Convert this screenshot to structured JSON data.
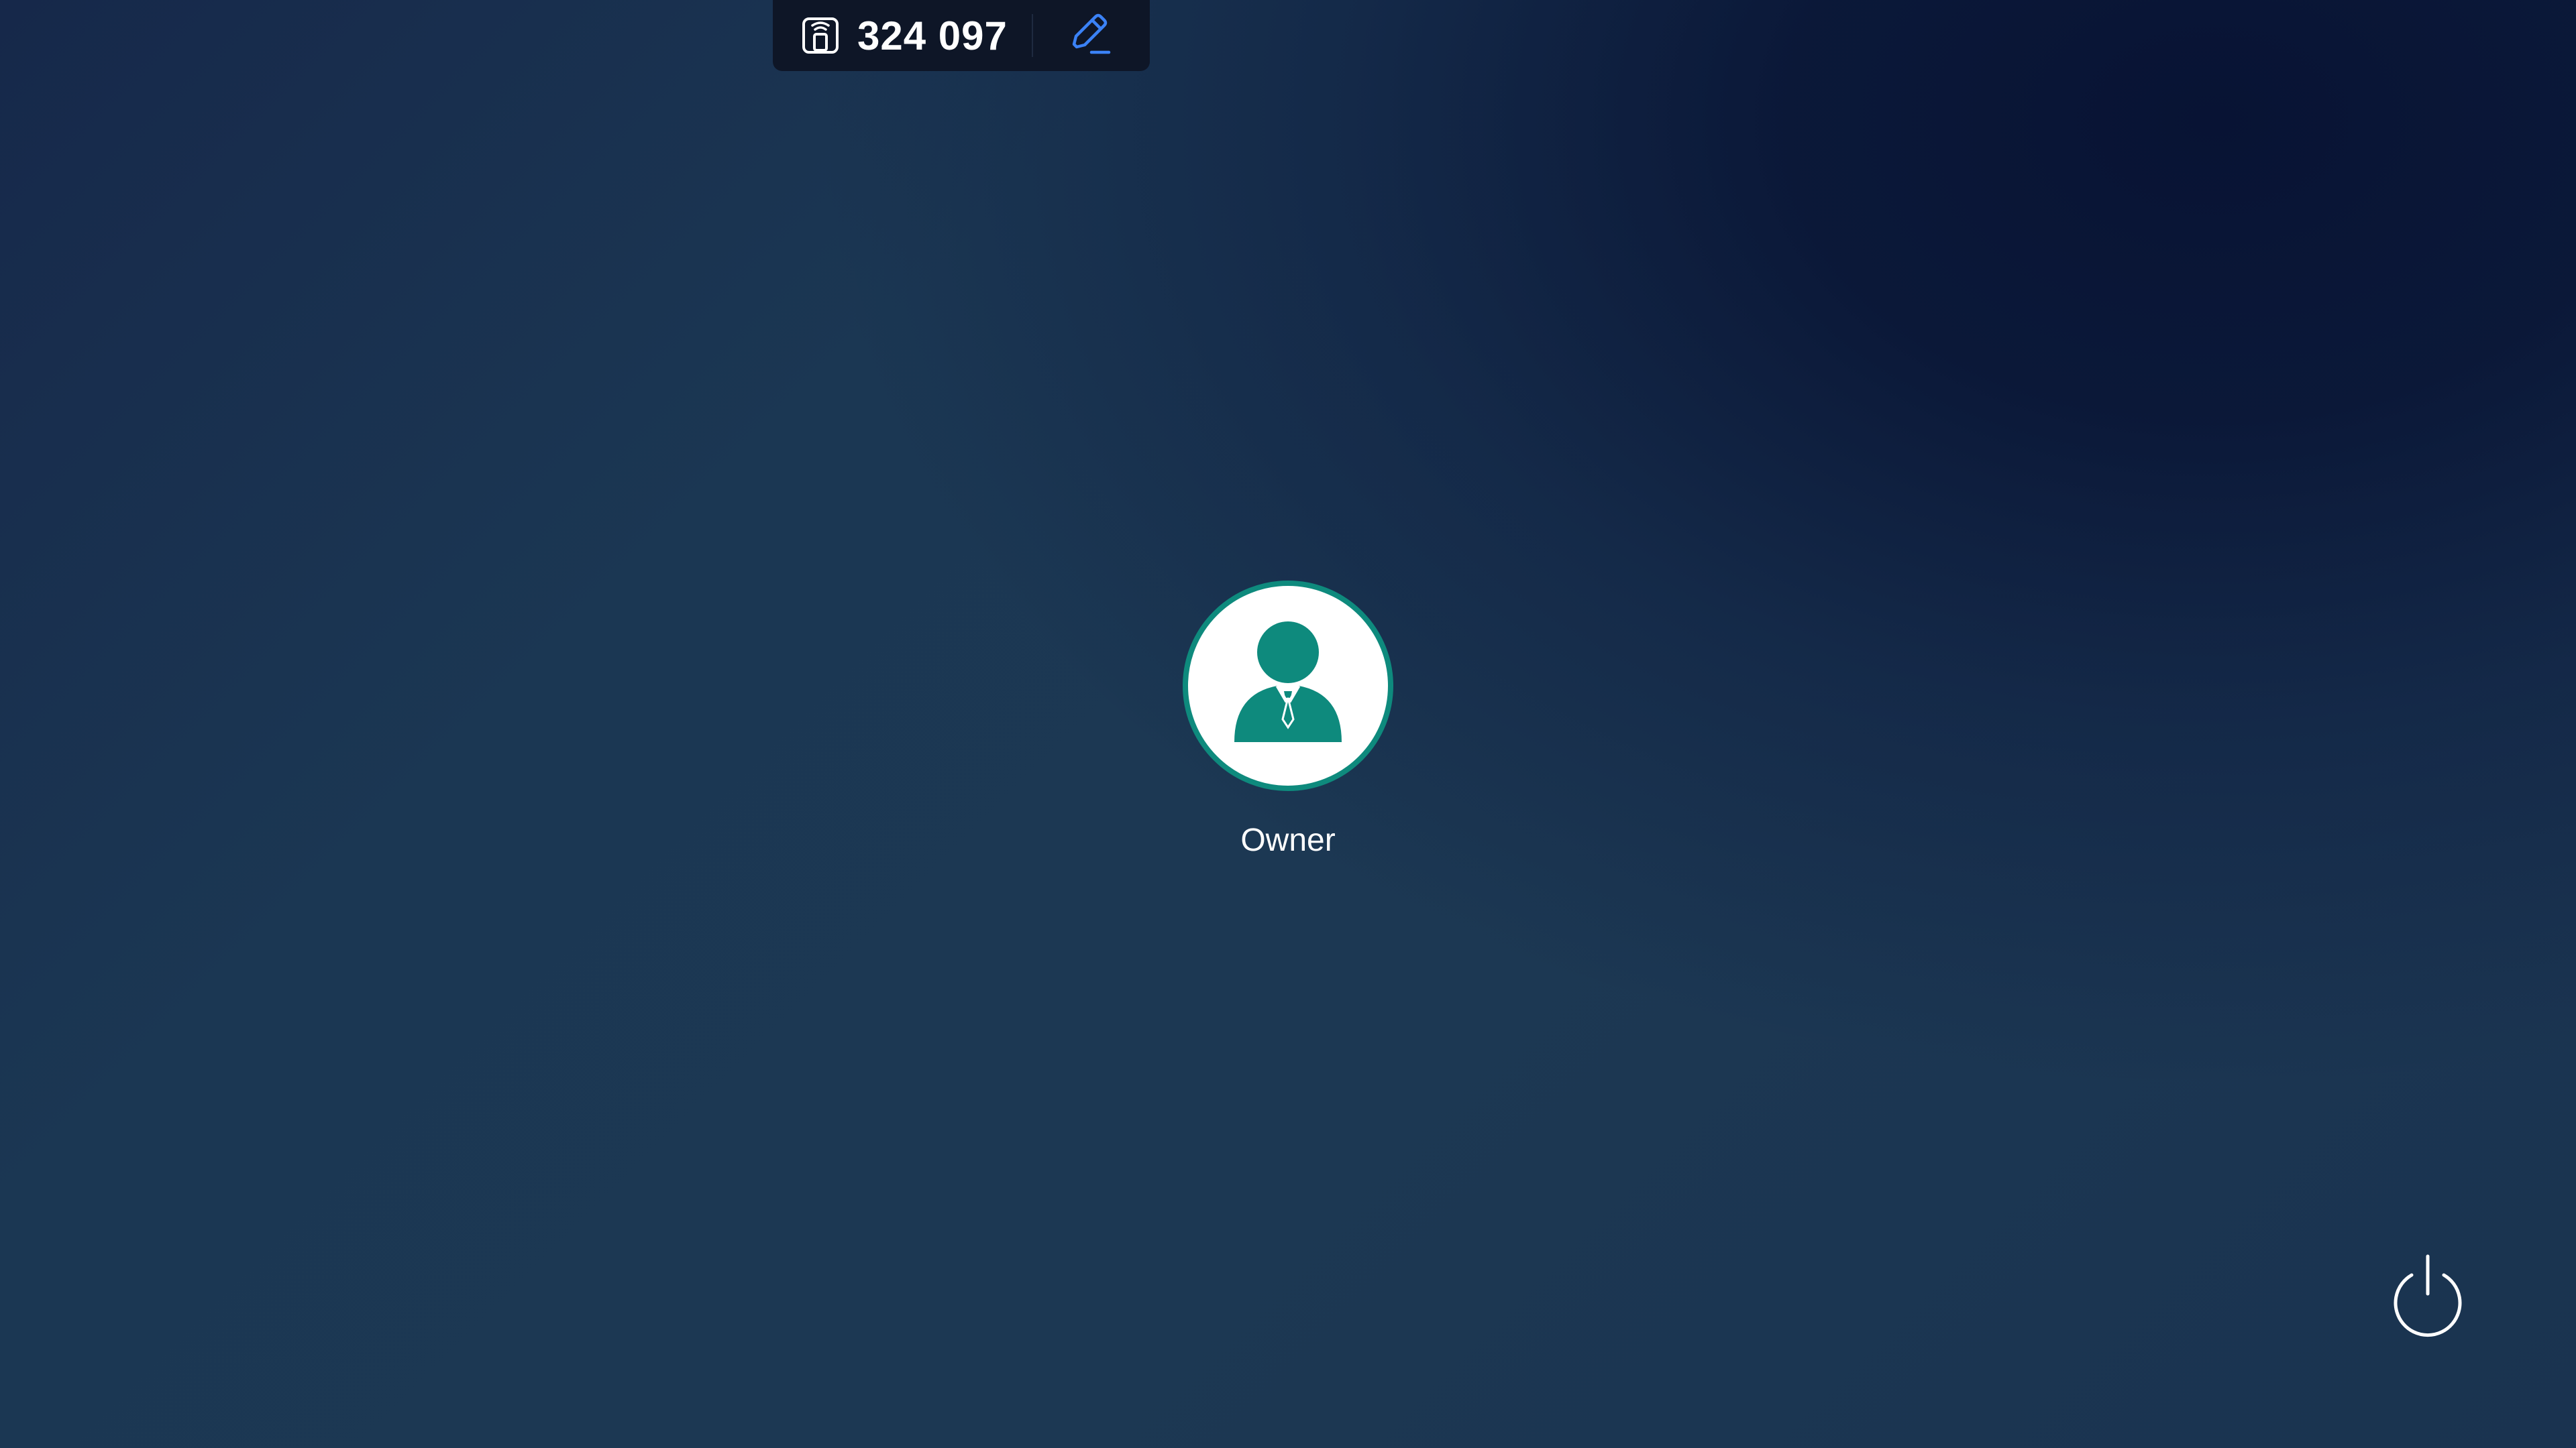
{
  "top_bar": {
    "session_id": "324 097",
    "device_icon": "remote-device-icon",
    "edit_icon": "pencil-edit-icon"
  },
  "user": {
    "name": "Owner",
    "avatar_icon": "user-avatar-icon"
  },
  "power": {
    "icon": "power-icon"
  },
  "colors": {
    "accent_teal": "#0e8a7d",
    "edit_blue": "#3b82f6",
    "bar_background": "#0e1627",
    "text": "#ffffff"
  }
}
